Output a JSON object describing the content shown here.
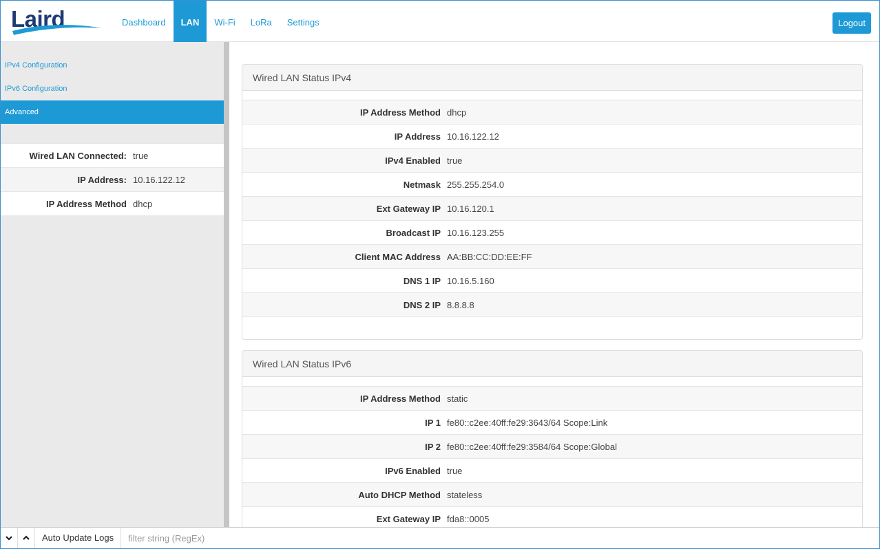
{
  "header": {
    "logo_text": "Laird",
    "nav": [
      "Dashboard",
      "LAN",
      "Wi-Fi",
      "LoRa",
      "Settings"
    ],
    "active_nav": "LAN",
    "logout_label": "Logout"
  },
  "sidebar": {
    "menu": [
      {
        "label": "IPv4 Configuration",
        "active": false
      },
      {
        "label": "IPv6 Configuration",
        "active": false
      },
      {
        "label": "Advanced",
        "active": true
      }
    ],
    "status": [
      {
        "key": "Wired LAN Connected:",
        "value": "true"
      },
      {
        "key": "IP Address:",
        "value": "10.16.122.12"
      },
      {
        "key": "IP Address Method",
        "value": "dhcp"
      }
    ]
  },
  "ipv4": {
    "title": "Wired LAN Status IPv4",
    "rows": [
      {
        "key": "IP Address Method",
        "value": "dhcp"
      },
      {
        "key": "IP Address",
        "value": "10.16.122.12"
      },
      {
        "key": "IPv4 Enabled",
        "value": "true"
      },
      {
        "key": "Netmask",
        "value": "255.255.254.0"
      },
      {
        "key": "Ext Gateway IP",
        "value": "10.16.120.1"
      },
      {
        "key": "Broadcast IP",
        "value": "10.16.123.255"
      },
      {
        "key": "Client MAC Address",
        "value": "AA:BB:CC:DD:EE:FF"
      },
      {
        "key": "DNS 1 IP",
        "value": "10.16.5.160"
      },
      {
        "key": "DNS 2 IP",
        "value": "8.8.8.8"
      }
    ]
  },
  "ipv6": {
    "title": "Wired LAN Status IPv6",
    "rows": [
      {
        "key": "IP Address Method",
        "value": "static"
      },
      {
        "key": "IP 1",
        "value": "fe80::c2ee:40ff:fe29:3643/64 Scope:Link"
      },
      {
        "key": "IP 2",
        "value": "fe80::c2ee:40ff:fe29:3584/64 Scope:Global"
      },
      {
        "key": "IPv6 Enabled",
        "value": "true"
      },
      {
        "key": "Auto DHCP Method",
        "value": "stateless"
      },
      {
        "key": "Ext Gateway IP",
        "value": "fda8::0005"
      }
    ]
  },
  "bottom": {
    "auto_update_label": "Auto Update Logs",
    "filter_placeholder": "filter string (RegEx)"
  },
  "colors": {
    "accent": "#1d9ad6",
    "brand_dark": "#1f3a73"
  },
  "icons": [
    "chevron-down-icon",
    "chevron-up-icon"
  ]
}
